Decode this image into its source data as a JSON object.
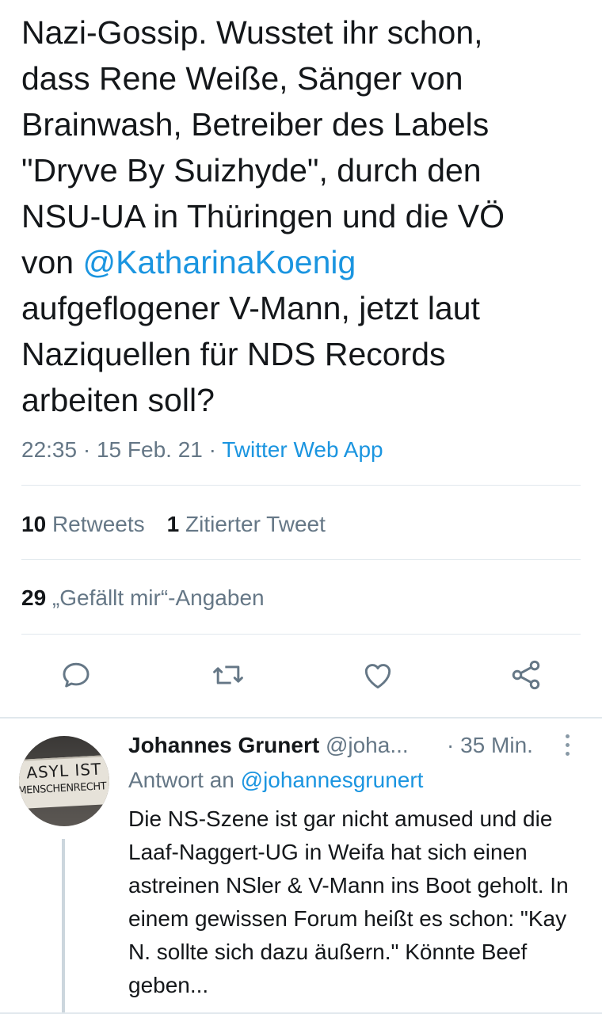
{
  "tweet": {
    "text_before_mention": "Nazi-Gossip. Wusstet ihr schon, dass Rene Weiße, Sänger von Brainwash, Betreiber des Labels \"Dryve By Suizhyde\", durch den NSU-UA in Thüringen und die VÖ von ",
    "mention": "@KatharinaKoenig",
    "text_after_mention": " aufgeflogener V-Mann, jetzt laut Naziquellen für NDS Records arbeiten soll?",
    "lines": [
      "Nazi-Gossip. Wusstet ihr schon,",
      "dass Rene Weiße, Sänger von",
      "Brainwash, Betreiber des Labels",
      "\"Dryve By Suizhyde\", durch den",
      "NSU-UA in Thüringen und die VÖ"
    ],
    "line_prefix_von": "von ",
    "line_after": [
      "aufgeflogener V-Mann, jetzt laut",
      "Naziquellen für NDS Records",
      "arbeiten soll?"
    ],
    "time": "22:35",
    "date": "15 Feb. 21",
    "sep": " · ",
    "source": "Twitter Web App"
  },
  "stats": {
    "retweets_count": "10",
    "retweets_label": "Retweets",
    "quotes_count": "1",
    "quotes_label": "Zitierter Tweet",
    "likes_count": "29",
    "likes_label": "„Gefällt mir“-Angaben"
  },
  "actions": {
    "reply_icon": "reply-icon",
    "retweet_icon": "retweet-icon",
    "like_icon": "heart-icon",
    "share_icon": "share-icon",
    "icon_color": "#657786"
  },
  "reply": {
    "name": "Johannes Grunert",
    "handle": "@joha...",
    "time": "· 35 Min.",
    "reply_to_label": "Antwort an",
    "reply_to_handle": "@johannesgrunert",
    "body": "Die NS-Szene ist gar nicht amused und die Laaf-Naggert-UG in Weifa hat sich einen astreinen NSler & V-Mann ins Boot geholt. In einem gewissen Forum heißt es schon: \"Kay N. sollte sich dazu äußern.\" Könnte Beef geben...",
    "avatar_sign_line1": "ASYL IST",
    "avatar_sign_line2": "MENSCHENRECHT"
  },
  "colors": {
    "link": "#1b95e0",
    "secondary": "#657786",
    "text": "#14171a",
    "divider": "#e1e8ed"
  }
}
